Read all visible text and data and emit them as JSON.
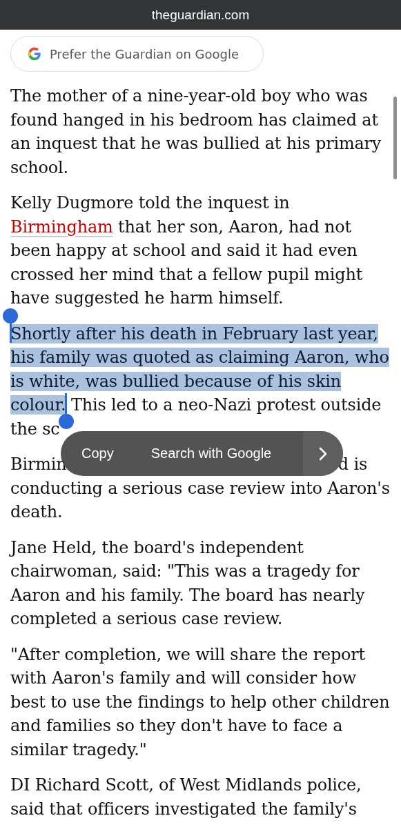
{
  "address_bar": {
    "domain": "theguardian.com"
  },
  "prefer_button": {
    "label": "Prefer the Guardian on Google"
  },
  "paragraphs": [
    {
      "segments": [
        {
          "kind": "plain",
          "text": "The mother of a nine-year-old boy who was found hanged in his bedroom has claimed at an inquest that he was bullied at his primary school."
        }
      ]
    },
    {
      "segments": [
        {
          "kind": "plain",
          "text": "Kelly Dugmore told the inquest in "
        },
        {
          "kind": "link",
          "text": "Birmingham"
        },
        {
          "kind": "plain",
          "text": " that her son, Aaron, had not been happy at school and said it had even crossed her mind that a fellow pupil might have suggested he harm himself."
        }
      ]
    },
    {
      "segments": [
        {
          "kind": "selected",
          "text": "Shortly after his death in February last year, his family was quoted as claiming Aaron, who is white, was bullied because of his skin colour."
        },
        {
          "kind": "plain",
          "text": " This led to a neo-Nazi protest outside the sc"
        }
      ]
    },
    {
      "lines": [
        {
          "left": "Birmin",
          "right": "d is"
        },
        {
          "left": "conducting a serious case review into Aaron's"
        },
        {
          "left": "death."
        }
      ]
    },
    {
      "segments": [
        {
          "kind": "plain",
          "text": "Jane Held, the board's independent chairwoman, said: \"This was a tragedy for Aaron and his family. The board has nearly completed a serious case review."
        }
      ]
    },
    {
      "segments": [
        {
          "kind": "plain",
          "text": "\"After completion, we will share the report with Aaron's family and will consider how best to use the findings to help other children and families so they don't have to face a similar tragedy.\""
        }
      ]
    },
    {
      "segments": [
        {
          "kind": "plain",
          "text": "DI Richard Scott, of West Midlands police, said that officers investigated the family's"
        }
      ]
    }
  ],
  "context_menu": {
    "items": [
      "Copy",
      "Search with Google"
    ]
  }
}
